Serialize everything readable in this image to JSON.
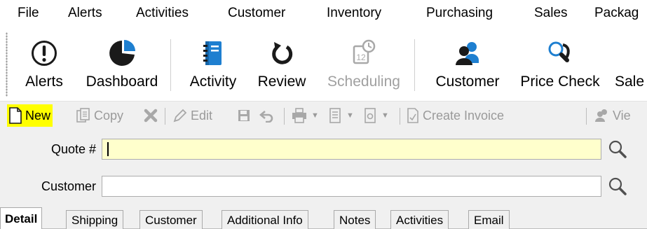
{
  "menu": {
    "items": [
      "File",
      "Alerts",
      "Activities",
      "Customer",
      "Inventory",
      "Purchasing",
      "Sales",
      "Packag"
    ]
  },
  "ribbon": {
    "alerts_label": "Alerts",
    "dashboard_label": "Dashboard",
    "activity_label": "Activity",
    "review_label": "Review",
    "scheduling_label": "Scheduling",
    "customer_label": "Customer",
    "price_check_label": "Price Check",
    "sale_label": "Sale"
  },
  "toolbar": {
    "new_label": "New",
    "copy_label": "Copy",
    "edit_label": "Edit",
    "create_invoice_label": "Create Invoice",
    "view_label": "Vie",
    "new_highlight_color": "#ffff00"
  },
  "form": {
    "quote_label": "Quote #",
    "quote_value": "",
    "customer_label": "Customer",
    "customer_value": ""
  },
  "tabs": [
    "Detail",
    "Shipping",
    "Customer",
    "Additional Info",
    "Notes",
    "Activities",
    "Email"
  ],
  "colors": {
    "quote_field_bg": "#ffffcc",
    "ribbon_icon_blue": "#1e7fd0",
    "ribbon_icon_dark": "#1a1a1a"
  }
}
